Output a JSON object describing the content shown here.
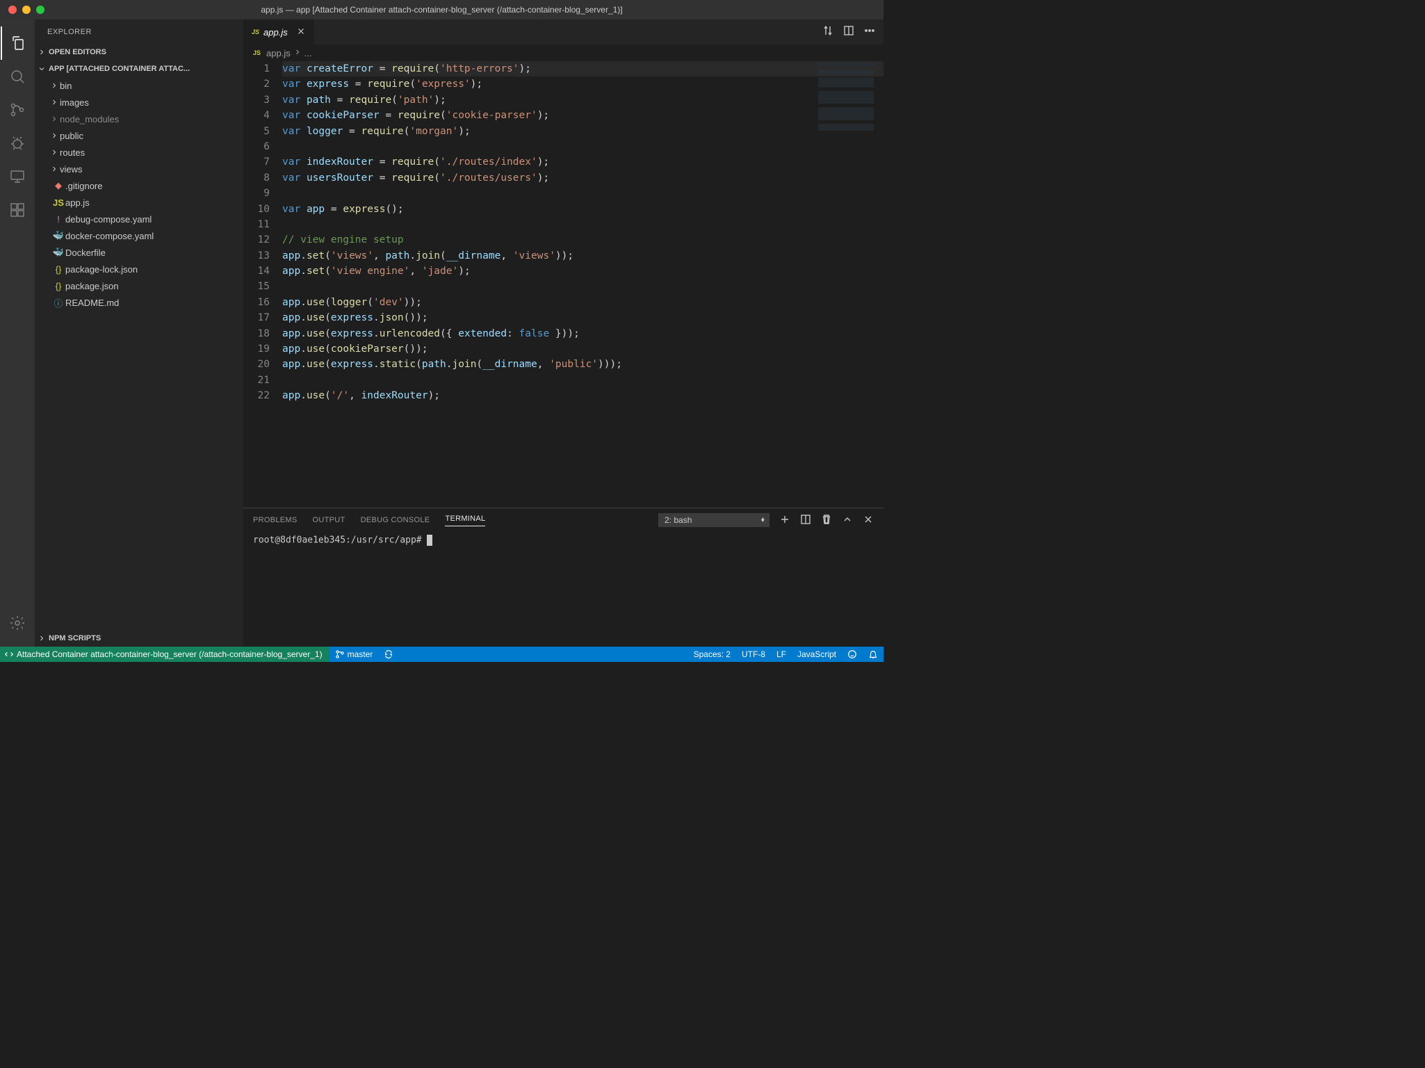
{
  "window": {
    "title": "app.js — app [Attached Container attach-container-blog_server (/attach-container-blog_server_1)]"
  },
  "sidebar": {
    "title": "EXPLORER",
    "openEditors": "OPEN EDITORS",
    "folderTitle": "APP [ATTACHED CONTAINER ATTAC...",
    "npmScripts": "NPM SCRIPTS",
    "folders": [
      {
        "name": "bin",
        "dimmed": false
      },
      {
        "name": "images",
        "dimmed": false
      },
      {
        "name": "node_modules",
        "dimmed": true
      },
      {
        "name": "public",
        "dimmed": false
      },
      {
        "name": "routes",
        "dimmed": false
      },
      {
        "name": "views",
        "dimmed": false
      }
    ],
    "files": [
      {
        "name": ".gitignore",
        "icon": "git"
      },
      {
        "name": "app.js",
        "icon": "js"
      },
      {
        "name": "debug-compose.yaml",
        "icon": "yaml"
      },
      {
        "name": "docker-compose.yaml",
        "icon": "whale"
      },
      {
        "name": "Dockerfile",
        "icon": "docker"
      },
      {
        "name": "package-lock.json",
        "icon": "json"
      },
      {
        "name": "package.json",
        "icon": "json"
      },
      {
        "name": "README.md",
        "icon": "info"
      }
    ]
  },
  "tabs": {
    "active": "app.js"
  },
  "breadcrumb": {
    "file": "app.js",
    "rest": "..."
  },
  "code": {
    "lines": [
      [
        [
          "kw",
          "var"
        ],
        [
          "pn",
          " "
        ],
        [
          "id",
          "createError"
        ],
        [
          "pn",
          " = "
        ],
        [
          "fn",
          "require"
        ],
        [
          "pn",
          "("
        ],
        [
          "str",
          "'http-errors'"
        ],
        [
          "pn",
          ");"
        ]
      ],
      [
        [
          "kw",
          "var"
        ],
        [
          "pn",
          " "
        ],
        [
          "id",
          "express"
        ],
        [
          "pn",
          " = "
        ],
        [
          "fn",
          "require"
        ],
        [
          "pn",
          "("
        ],
        [
          "str",
          "'express'"
        ],
        [
          "pn",
          ");"
        ]
      ],
      [
        [
          "kw",
          "var"
        ],
        [
          "pn",
          " "
        ],
        [
          "id",
          "path"
        ],
        [
          "pn",
          " = "
        ],
        [
          "fn",
          "require"
        ],
        [
          "pn",
          "("
        ],
        [
          "str",
          "'path'"
        ],
        [
          "pn",
          ");"
        ]
      ],
      [
        [
          "kw",
          "var"
        ],
        [
          "pn",
          " "
        ],
        [
          "id",
          "cookieParser"
        ],
        [
          "pn",
          " = "
        ],
        [
          "fn",
          "require"
        ],
        [
          "pn",
          "("
        ],
        [
          "str",
          "'cookie-parser'"
        ],
        [
          "pn",
          ");"
        ]
      ],
      [
        [
          "kw",
          "var"
        ],
        [
          "pn",
          " "
        ],
        [
          "id",
          "logger"
        ],
        [
          "pn",
          " = "
        ],
        [
          "fn",
          "require"
        ],
        [
          "pn",
          "("
        ],
        [
          "str",
          "'morgan'"
        ],
        [
          "pn",
          ");"
        ]
      ],
      [],
      [
        [
          "kw",
          "var"
        ],
        [
          "pn",
          " "
        ],
        [
          "id",
          "indexRouter"
        ],
        [
          "pn",
          " = "
        ],
        [
          "fn",
          "require"
        ],
        [
          "pn",
          "("
        ],
        [
          "str",
          "'./routes/index'"
        ],
        [
          "pn",
          ");"
        ]
      ],
      [
        [
          "kw",
          "var"
        ],
        [
          "pn",
          " "
        ],
        [
          "id",
          "usersRouter"
        ],
        [
          "pn",
          " = "
        ],
        [
          "fn",
          "require"
        ],
        [
          "pn",
          "("
        ],
        [
          "str",
          "'./routes/users'"
        ],
        [
          "pn",
          ");"
        ]
      ],
      [],
      [
        [
          "kw",
          "var"
        ],
        [
          "pn",
          " "
        ],
        [
          "id",
          "app"
        ],
        [
          "pn",
          " = "
        ],
        [
          "fn",
          "express"
        ],
        [
          "pn",
          "();"
        ]
      ],
      [],
      [
        [
          "cm",
          "// view engine setup"
        ]
      ],
      [
        [
          "id",
          "app"
        ],
        [
          "pn",
          "."
        ],
        [
          "fn",
          "set"
        ],
        [
          "pn",
          "("
        ],
        [
          "str",
          "'views'"
        ],
        [
          "pn",
          ", "
        ],
        [
          "id",
          "path"
        ],
        [
          "pn",
          "."
        ],
        [
          "fn",
          "join"
        ],
        [
          "pn",
          "("
        ],
        [
          "id",
          "__dirname"
        ],
        [
          "pn",
          ", "
        ],
        [
          "str",
          "'views'"
        ],
        [
          "pn",
          "));"
        ]
      ],
      [
        [
          "id",
          "app"
        ],
        [
          "pn",
          "."
        ],
        [
          "fn",
          "set"
        ],
        [
          "pn",
          "("
        ],
        [
          "str",
          "'view engine'"
        ],
        [
          "pn",
          ", "
        ],
        [
          "str",
          "'jade'"
        ],
        [
          "pn",
          ");"
        ]
      ],
      [],
      [
        [
          "id",
          "app"
        ],
        [
          "pn",
          "."
        ],
        [
          "fn",
          "use"
        ],
        [
          "pn",
          "("
        ],
        [
          "fn",
          "logger"
        ],
        [
          "pn",
          "("
        ],
        [
          "str",
          "'dev'"
        ],
        [
          "pn",
          "));"
        ]
      ],
      [
        [
          "id",
          "app"
        ],
        [
          "pn",
          "."
        ],
        [
          "fn",
          "use"
        ],
        [
          "pn",
          "("
        ],
        [
          "id",
          "express"
        ],
        [
          "pn",
          "."
        ],
        [
          "fn",
          "json"
        ],
        [
          "pn",
          "());"
        ]
      ],
      [
        [
          "id",
          "app"
        ],
        [
          "pn",
          "."
        ],
        [
          "fn",
          "use"
        ],
        [
          "pn",
          "("
        ],
        [
          "id",
          "express"
        ],
        [
          "pn",
          "."
        ],
        [
          "fn",
          "urlencoded"
        ],
        [
          "pn",
          "({ "
        ],
        [
          "id",
          "extended"
        ],
        [
          "pn",
          ": "
        ],
        [
          "bl",
          "false"
        ],
        [
          "pn",
          " }));"
        ]
      ],
      [
        [
          "id",
          "app"
        ],
        [
          "pn",
          "."
        ],
        [
          "fn",
          "use"
        ],
        [
          "pn",
          "("
        ],
        [
          "fn",
          "cookieParser"
        ],
        [
          "pn",
          "());"
        ]
      ],
      [
        [
          "id",
          "app"
        ],
        [
          "pn",
          "."
        ],
        [
          "fn",
          "use"
        ],
        [
          "pn",
          "("
        ],
        [
          "id",
          "express"
        ],
        [
          "pn",
          "."
        ],
        [
          "fn",
          "static"
        ],
        [
          "pn",
          "("
        ],
        [
          "id",
          "path"
        ],
        [
          "pn",
          "."
        ],
        [
          "fn",
          "join"
        ],
        [
          "pn",
          "("
        ],
        [
          "id",
          "__dirname"
        ],
        [
          "pn",
          ", "
        ],
        [
          "str",
          "'public'"
        ],
        [
          "pn",
          ")));"
        ]
      ],
      [],
      [
        [
          "id",
          "app"
        ],
        [
          "pn",
          "."
        ],
        [
          "fn",
          "use"
        ],
        [
          "pn",
          "("
        ],
        [
          "str",
          "'/'"
        ],
        [
          "pn",
          ", "
        ],
        [
          "id",
          "indexRouter"
        ],
        [
          "pn",
          ");"
        ]
      ]
    ]
  },
  "panel": {
    "tabs": {
      "problems": "PROBLEMS",
      "output": "OUTPUT",
      "debug": "DEBUG CONSOLE",
      "terminal": "TERMINAL"
    },
    "terminalSelect": "2: bash",
    "prompt": "root@8df0ae1eb345:/usr/src/app# "
  },
  "status": {
    "remote": "Attached Container attach-container-blog_server (/attach-container-blog_server_1)",
    "branch": "master",
    "spaces": "Spaces: 2",
    "encoding": "UTF-8",
    "eol": "LF",
    "lang": "JavaScript"
  }
}
